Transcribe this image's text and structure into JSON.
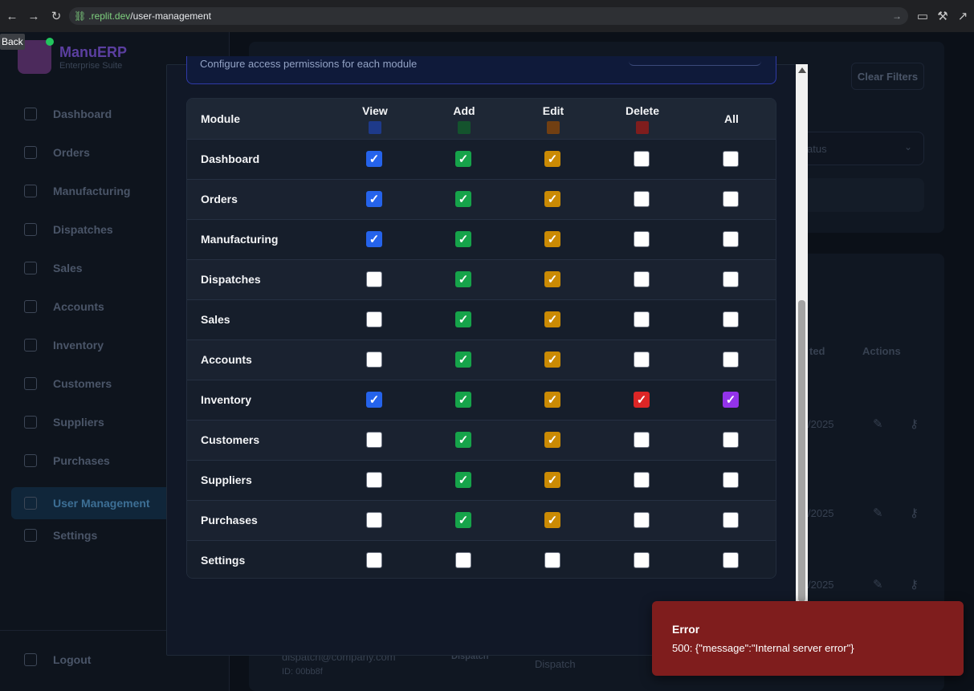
{
  "browser": {
    "url_domain": ".replit.dev",
    "url_path": "/user-management",
    "back_tooltip": "Back",
    "icons": [
      "arrow-left-icon",
      "arrow-right-icon",
      "reload-icon",
      "link-icon"
    ]
  },
  "sidebar": {
    "brand_name": "ManuERP",
    "brand_sub": "Enterprise Suite",
    "items": [
      {
        "label": "Dashboard",
        "icon": "grid-icon"
      },
      {
        "label": "Orders",
        "icon": "cart-icon"
      },
      {
        "label": "Manufacturing",
        "icon": "cog-icon"
      },
      {
        "label": "Dispatches",
        "icon": "truck-icon"
      },
      {
        "label": "Sales",
        "icon": "trend-icon"
      },
      {
        "label": "Accounts",
        "icon": "calculator-icon"
      },
      {
        "label": "Inventory",
        "icon": "box-icon"
      },
      {
        "label": "Customers",
        "icon": "users-icon"
      },
      {
        "label": "Suppliers",
        "icon": "handshake-icon"
      },
      {
        "label": "Purchases",
        "icon": "receipt-icon"
      },
      {
        "label": "User Management",
        "icon": "shield-icon"
      },
      {
        "label": "Settings",
        "icon": "gear-icon"
      }
    ],
    "logout": "Logout"
  },
  "background": {
    "clear_filters": "Clear Filters",
    "status_placeholder": "atus",
    "col_created_fragment": "ted",
    "col_actions": "Actions",
    "date_fragment": "/2025",
    "email": "dispatch@company.com",
    "user_id": "ID: 00bb8f",
    "role_badge": "Dispatch",
    "role": "Dispatch"
  },
  "modal": {
    "info_text": "Configure access permissions for each module",
    "headers": {
      "module": "Module",
      "view": "View",
      "add": "Add",
      "edit": "Edit",
      "delete": "Delete",
      "all": "All"
    },
    "colors": {
      "view": "#2563eb",
      "add": "#16a34a",
      "edit": "#ca8a04",
      "delete": "#dc2626",
      "all": "#9333ea"
    },
    "rows": [
      {
        "module": "Dashboard",
        "view": true,
        "add": true,
        "edit": true,
        "delete": false,
        "all": false
      },
      {
        "module": "Orders",
        "view": true,
        "add": true,
        "edit": true,
        "delete": false,
        "all": false
      },
      {
        "module": "Manufacturing",
        "view": true,
        "add": true,
        "edit": true,
        "delete": false,
        "all": false
      },
      {
        "module": "Dispatches",
        "view": false,
        "add": true,
        "edit": true,
        "delete": false,
        "all": false
      },
      {
        "module": "Sales",
        "view": false,
        "add": true,
        "edit": true,
        "delete": false,
        "all": false
      },
      {
        "module": "Accounts",
        "view": false,
        "add": true,
        "edit": true,
        "delete": false,
        "all": false
      },
      {
        "module": "Inventory",
        "view": true,
        "add": true,
        "edit": true,
        "delete": true,
        "all": true
      },
      {
        "module": "Customers",
        "view": false,
        "add": true,
        "edit": true,
        "delete": false,
        "all": false
      },
      {
        "module": "Suppliers",
        "view": false,
        "add": true,
        "edit": true,
        "delete": false,
        "all": false
      },
      {
        "module": "Purchases",
        "view": false,
        "add": true,
        "edit": true,
        "delete": false,
        "all": false
      },
      {
        "module": "Settings",
        "view": false,
        "add": false,
        "edit": false,
        "delete": false,
        "all": false
      }
    ]
  },
  "toast": {
    "title": "Error",
    "message": "500: {\"message\":\"Internal server error\"}"
  }
}
